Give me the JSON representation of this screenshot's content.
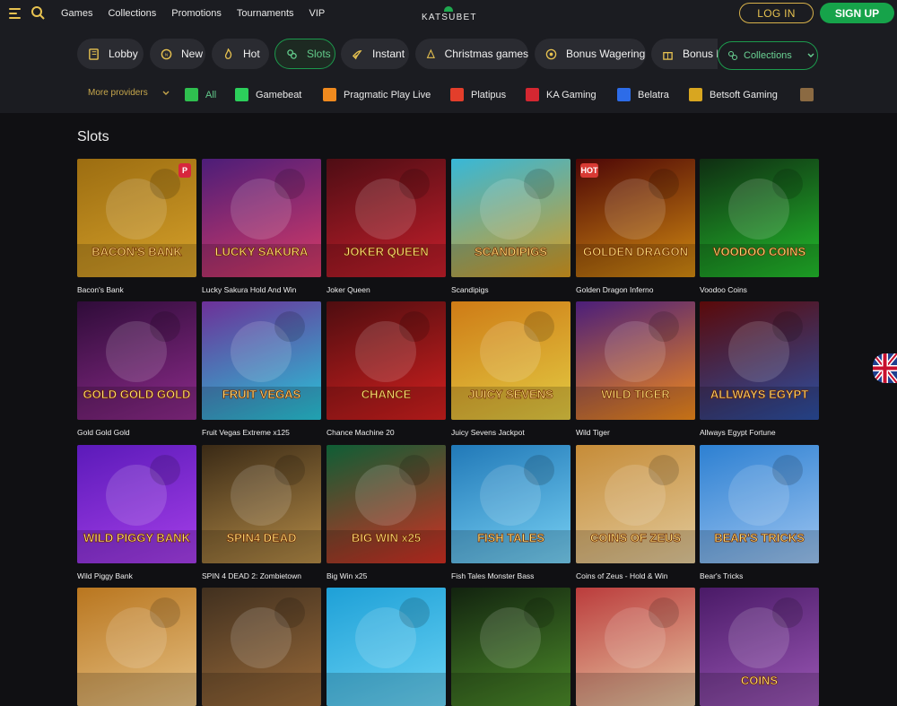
{
  "header": {
    "nav": [
      "Games",
      "Collections",
      "Promotions",
      "Tournaments",
      "VIP"
    ],
    "logo": "KATSUBET",
    "login": "LOG IN",
    "signup": "SIGN UP"
  },
  "categories": [
    {
      "label": "Lobby",
      "icon": "book-icon"
    },
    {
      "label": "New",
      "icon": "new-icon"
    },
    {
      "label": "Hot",
      "icon": "flame-icon"
    },
    {
      "label": "Slots",
      "icon": "slots-icon",
      "active": true
    },
    {
      "label": "Instant",
      "icon": "rocket-icon"
    },
    {
      "label": "Christmas games",
      "icon": "christmas-icon"
    },
    {
      "label": "Bonus Wagering",
      "icon": "bonus-wagering-icon"
    },
    {
      "label": "Bonus B",
      "icon": "gift-icon"
    }
  ],
  "collections_label": "Collections",
  "providers": [
    {
      "label": "More providers",
      "icon": "chevron-down-icon"
    },
    {
      "label": "All",
      "icon": "all-grid-icon"
    },
    {
      "label": "Gamebeat",
      "icon": "gamebeat-icon"
    },
    {
      "label": "Pragmatic Play Live",
      "icon": "pragmatic-live-icon"
    },
    {
      "label": "Platipus",
      "icon": "platipus-icon"
    },
    {
      "label": "KA Gaming",
      "icon": "ka-gaming-icon"
    },
    {
      "label": "Belatra",
      "icon": "belatra-icon"
    },
    {
      "label": "Betsoft Gaming",
      "icon": "betsoft-icon"
    }
  ],
  "section_title": "Slots",
  "games": [
    {
      "title": "Bacon's Bank",
      "art": "BACON'S BANK",
      "colors": [
        "#9c6d11",
        "#d6a12a"
      ],
      "badge": "P"
    },
    {
      "title": "Lucky Sakura Hold And Win",
      "art": "LUCKY SAKURA",
      "colors": [
        "#4c1d78",
        "#d83b67"
      ],
      "badge": ""
    },
    {
      "title": "Joker Queen",
      "art": "JOKER QUEEN",
      "colors": [
        "#4e0d14",
        "#c61f2b"
      ],
      "badge": ""
    },
    {
      "title": "Scandipigs",
      "art": "SCANDIPIGS",
      "colors": [
        "#37b8d8",
        "#d89b1f"
      ],
      "badge": ""
    },
    {
      "title": "Golden Dragon Inferno",
      "art": "GOLDEN DRAGON",
      "colors": [
        "#4d0606",
        "#d28a11"
      ],
      "badge": "HOT"
    },
    {
      "title": "Voodoo Coins",
      "art": "VOODOO COINS",
      "colors": [
        "#0f2d12",
        "#23bd2c"
      ],
      "badge": ""
    },
    {
      "title": "Gold Gold Gold",
      "art": "GOLD GOLD GOLD",
      "colors": [
        "#2f0c39",
        "#8d2b8b"
      ],
      "badge": ""
    },
    {
      "title": "Fruit Vegas Extreme x125",
      "art": "FRUIT VEGAS",
      "colors": [
        "#6d3098",
        "#28c6d8"
      ],
      "badge": ""
    },
    {
      "title": "Chance Machine 20",
      "art": "CHANCE",
      "colors": [
        "#4e0d10",
        "#d3201f"
      ],
      "badge": ""
    },
    {
      "title": "Juicy Sevens Jackpot",
      "art": "JUICY SEVENS",
      "colors": [
        "#ce7b16",
        "#e3cb43"
      ],
      "badge": ""
    },
    {
      "title": "Wild Tiger",
      "art": "WILD TIGER",
      "colors": [
        "#4b1e7a",
        "#f28b1b"
      ],
      "badge": ""
    },
    {
      "title": "Allways Egypt Fortune",
      "art": "ALLWAYS EGYPT",
      "colors": [
        "#5a0909",
        "#2c50a3"
      ],
      "badge": ""
    },
    {
      "title": "Wild Piggy Bank",
      "art": "WILD PIGGY BANK",
      "colors": [
        "#5b1ab9",
        "#a63fe9"
      ],
      "badge": ""
    },
    {
      "title": "SPIN 4 DEAD 2: Zombietown",
      "art": "SPIN4 DEAD",
      "colors": [
        "#3a2a16",
        "#b48b47"
      ],
      "badge": ""
    },
    {
      "title": "Big Win x25",
      "art": "BIG WIN x25",
      "colors": [
        "#0e5e35",
        "#d12f23"
      ],
      "badge": ""
    },
    {
      "title": "Fish Tales Monster Bass",
      "art": "FISH TALES",
      "colors": [
        "#2179b8",
        "#77d0f3"
      ],
      "badge": ""
    },
    {
      "title": "Coins of Zeus - Hold & Win",
      "art": "COINS OF ZEUS",
      "colors": [
        "#c68c38",
        "#e1c99a"
      ],
      "badge": ""
    },
    {
      "title": "Bear's Tricks",
      "art": "BEAR'S TRICKS",
      "colors": [
        "#2d80d2",
        "#9cc4f0"
      ],
      "badge": ""
    },
    {
      "title": "",
      "art": "",
      "colors": [
        "#b9761f",
        "#e5c083"
      ],
      "badge": ""
    },
    {
      "title": "",
      "art": "",
      "colors": [
        "#41301f",
        "#9a6b3a"
      ],
      "badge": ""
    },
    {
      "title": "",
      "art": "",
      "colors": [
        "#1ea0d7",
        "#6ad3f4"
      ],
      "badge": ""
    },
    {
      "title": "",
      "art": "",
      "colors": [
        "#12230f",
        "#4c8b2a"
      ],
      "badge": ""
    },
    {
      "title": "",
      "art": "",
      "colors": [
        "#bb3c3c",
        "#e7c6a2"
      ],
      "badge": ""
    },
    {
      "title": "",
      "art": "COINS",
      "colors": [
        "#4a1a67",
        "#9a57b5"
      ],
      "badge": ""
    }
  ],
  "language_flag": "uk-flag-icon"
}
